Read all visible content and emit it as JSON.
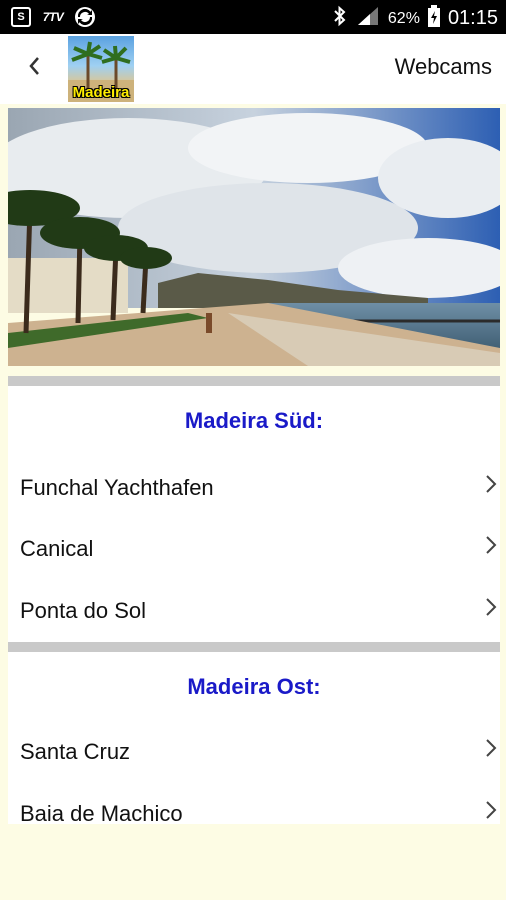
{
  "status_bar": {
    "tv_label": "7TV",
    "battery": "62%",
    "time": "01:15"
  },
  "app_bar": {
    "title": "Webcams",
    "logo_text": "Madeira"
  },
  "sections": [
    {
      "title": "Madeira Süd:",
      "items": [
        "Funchal Yachthafen",
        "Canical",
        "Ponta do Sol"
      ]
    },
    {
      "title": "Madeira Ost:",
      "items": [
        "Santa Cruz",
        "Baia de Machico"
      ]
    }
  ],
  "icons": {
    "back": "chevron-left-icon",
    "row": "chevron-right-icon"
  }
}
